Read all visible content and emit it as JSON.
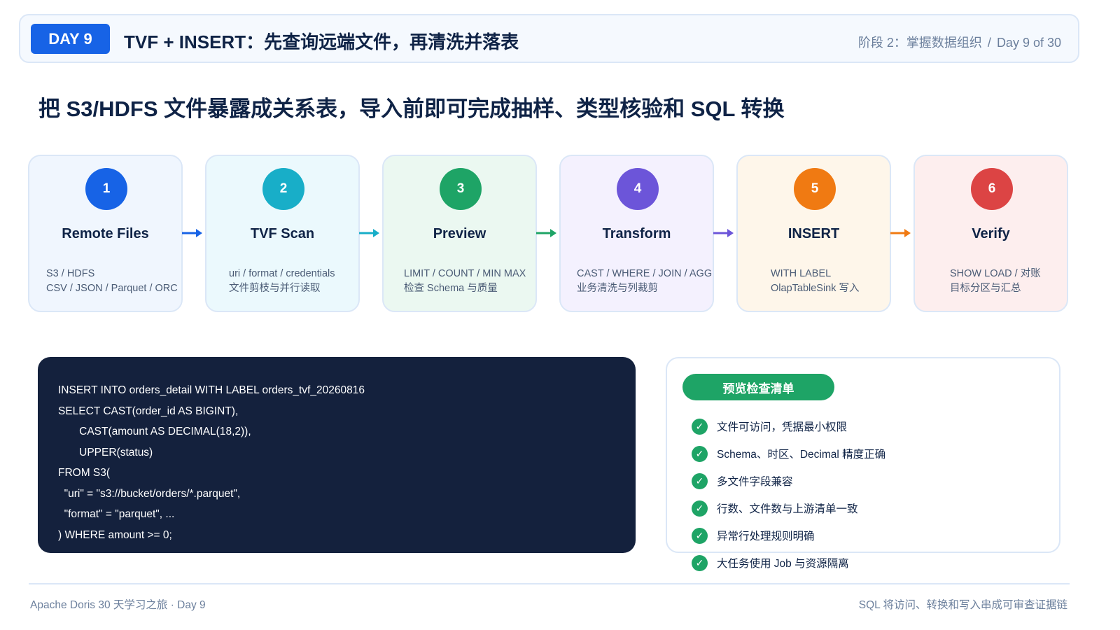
{
  "header": {
    "badge": "DAY 9",
    "title": "TVF + INSERT：先查询远端文件，再清洗并落表",
    "stage": "阶段 2：掌握数据组织",
    "separator": "/",
    "progress": "Day 9 of 30"
  },
  "subtitle": "把 S3/HDFS 文件暴露成关系表，导入前即可完成抽样、类型核验和 SQL 转换",
  "steps": [
    {
      "num": "1",
      "name": "Remote Files",
      "line1": "S3 / HDFS",
      "line2": "CSV / JSON / Parquet / ORC",
      "color": "#1763e6",
      "bg": "#f0f6fe"
    },
    {
      "num": "2",
      "name": "TVF Scan",
      "line1": "uri / format / credentials",
      "line2": "文件剪枝与并行读取",
      "color": "#18aec8",
      "bg": "#ebf9fd"
    },
    {
      "num": "3",
      "name": "Preview",
      "line1": "LIMIT / COUNT / MIN MAX",
      "line2": "检查 Schema 与质量",
      "color": "#1ea466",
      "bg": "#ebf8f1"
    },
    {
      "num": "4",
      "name": "Transform",
      "line1": "CAST / WHERE / JOIN / AGG",
      "line2": "业务清洗与列裁剪",
      "color": "#6c55d9",
      "bg": "#f4f1fe"
    },
    {
      "num": "5",
      "name": "INSERT",
      "line1": "WITH LABEL",
      "line2": "OlapTableSink 写入",
      "color": "#f07a12",
      "bg": "#fef6ea"
    },
    {
      "num": "6",
      "name": "Verify",
      "line1": "SHOW LOAD / 对账",
      "line2": "目标分区与汇总",
      "color": "#dc4444",
      "bg": "#fdeeee"
    }
  ],
  "code": [
    "INSERT INTO orders_detail WITH LABEL orders_tvf_20260816",
    "SELECT CAST(order_id AS BIGINT),",
    "       CAST(amount AS DECIMAL(18,2)),",
    "       UPPER(status)",
    "FROM S3(",
    "  \"uri\" = \"s3://bucket/orders/*.parquet\",",
    "  \"format\" = \"parquet\", ...",
    ") WHERE amount >= 0;"
  ],
  "checklist": {
    "title": "预览检查清单",
    "items": [
      "文件可访问，凭据最小权限",
      "Schema、时区、Decimal 精度正确",
      "多文件字段兼容",
      "行数、文件数与上游清单一致",
      "异常行处理规则明确",
      "大任务使用 Job 与资源隔离"
    ]
  },
  "footer": {
    "left": "Apache Doris 30 天学习之旅 · Day 9",
    "right": "SQL 将访问、转换和写入串成可审查证据链"
  }
}
